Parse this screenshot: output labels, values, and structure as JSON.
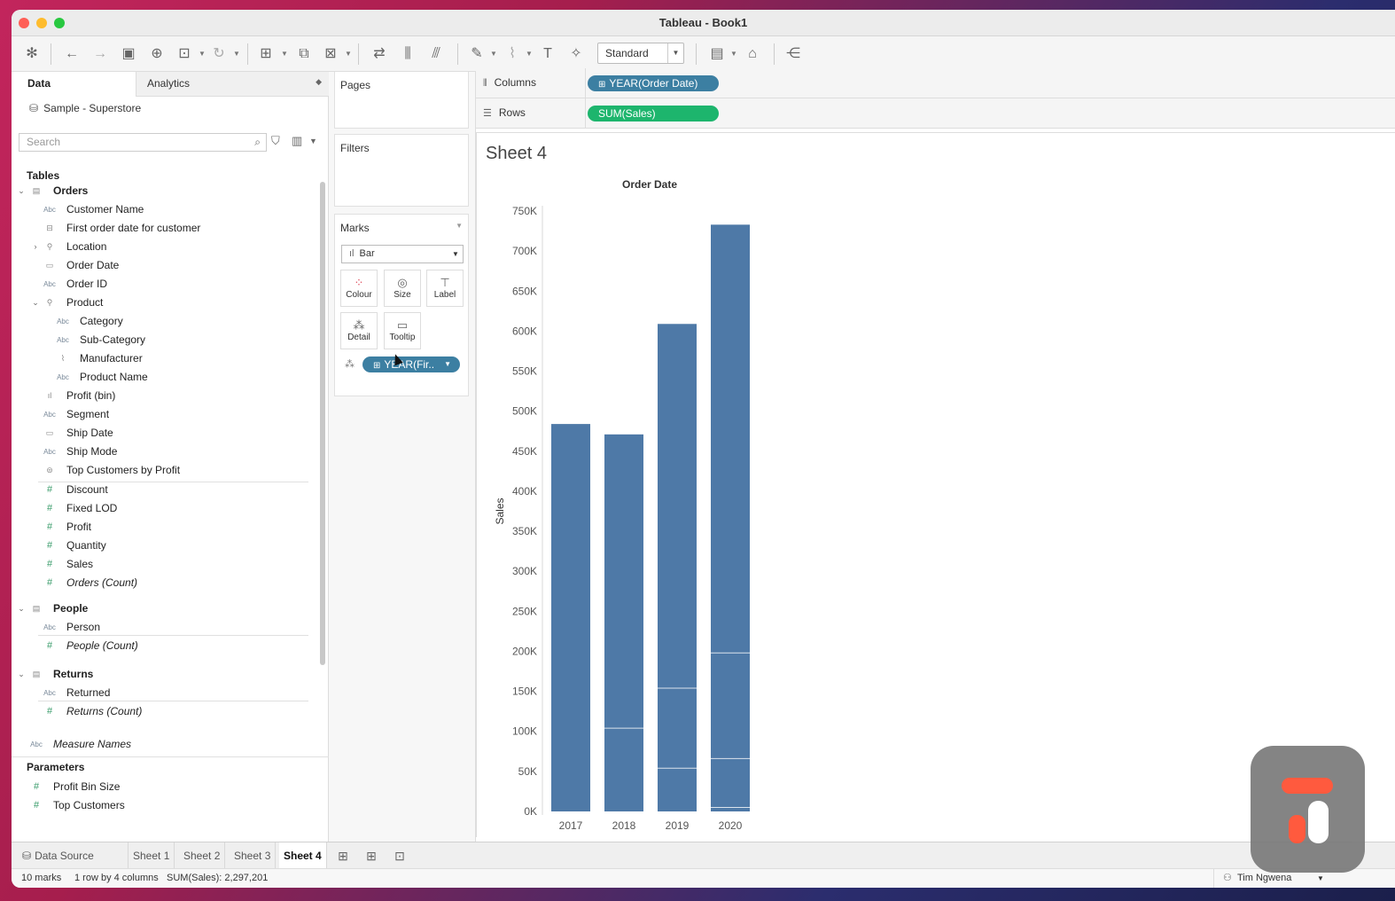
{
  "window": {
    "title": "Tableau - Book1"
  },
  "toolbar": {
    "view_select": "Standard"
  },
  "data_pane": {
    "tab_data": "Data",
    "tab_analytics": "Analytics",
    "datasource": "Sample - Superstore",
    "search_placeholder": "Search",
    "tables_heading": "Tables",
    "tables": [
      {
        "name": "Orders",
        "fields": [
          {
            "icon": "Abc",
            "name": "Customer Name"
          },
          {
            "icon": "date-group",
            "name": "First order date for customer"
          },
          {
            "icon": "hierarchy",
            "name": "Location"
          },
          {
            "icon": "date",
            "name": "Order Date"
          },
          {
            "icon": "Abc",
            "name": "Order ID"
          },
          {
            "icon": "hierarchy",
            "name": "Product"
          },
          {
            "icon": "Abc",
            "name": "Category"
          },
          {
            "icon": "Abc",
            "name": "Sub-Category"
          },
          {
            "icon": "clip",
            "name": "Manufacturer"
          },
          {
            "icon": "Abc",
            "name": "Product Name"
          },
          {
            "icon": "bin",
            "name": "Profit (bin)"
          },
          {
            "icon": "Abc",
            "name": "Segment"
          },
          {
            "icon": "date",
            "name": "Ship Date"
          },
          {
            "icon": "Abc",
            "name": "Ship Mode"
          },
          {
            "icon": "set",
            "name": "Top Customers by Profit"
          },
          {
            "icon": "#",
            "name": "Discount"
          },
          {
            "icon": "#",
            "name": "Fixed LOD"
          },
          {
            "icon": "#",
            "name": "Profit"
          },
          {
            "icon": "#",
            "name": "Quantity"
          },
          {
            "icon": "#",
            "name": "Sales"
          },
          {
            "icon": "#",
            "name": "Orders (Count)"
          }
        ]
      },
      {
        "name": "People",
        "fields": [
          {
            "icon": "Abc",
            "name": "Person"
          },
          {
            "icon": "#",
            "name": "People (Count)"
          }
        ]
      },
      {
        "name": "Returns",
        "fields": [
          {
            "icon": "Abc",
            "name": "Returned"
          },
          {
            "icon": "#",
            "name": "Returns (Count)"
          }
        ]
      }
    ],
    "measure_names": "Measure Names",
    "parameters_heading": "Parameters",
    "parameters": [
      "Profit Bin Size",
      "Top Customers"
    ]
  },
  "shelves": {
    "pages": "Pages",
    "filters": "Filters",
    "marks": "Marks",
    "mark_type": "Bar",
    "mark_buttons": [
      "Colour",
      "Size",
      "Label",
      "Detail",
      "Tooltip"
    ],
    "detail_pill": "YEAR(Fir..",
    "columns_label": "Columns",
    "columns_pill": "YEAR(Order Date)",
    "rows_label": "Rows",
    "rows_pill": "SUM(Sales)"
  },
  "sheet": {
    "title": "Sheet 4"
  },
  "chart_data": {
    "type": "bar",
    "title": "Order Date",
    "xlabel": "",
    "ylabel": "Sales",
    "categories": [
      "2017",
      "2018",
      "2019",
      "2020"
    ],
    "values": [
      484000,
      471000,
      609000,
      733000
    ],
    "segment_boundaries": [
      [],
      [
        104000
      ],
      [
        54000,
        154000
      ],
      [
        5000,
        66000,
        198000
      ]
    ],
    "ylim": [
      0,
      750000
    ],
    "yticks": [
      "0K",
      "50K",
      "100K",
      "150K",
      "200K",
      "250K",
      "300K",
      "350K",
      "400K",
      "450K",
      "500K",
      "550K",
      "600K",
      "650K",
      "700K",
      "750K"
    ],
    "bar_color": "#4e79a7",
    "grid": false
  },
  "tabs": {
    "data_source": "Data Source",
    "sheets": [
      "Sheet 1",
      "Sheet 2",
      "Sheet 3",
      "Sheet 4"
    ],
    "active": "Sheet 4"
  },
  "status": {
    "marks": "10 marks",
    "dims": "1 row by 4 columns",
    "sum": "SUM(Sales): 2,297,201",
    "user": "Tim Ngwena"
  },
  "colors": {
    "pill_blue": "#3c7fa2",
    "pill_green": "#1db56d",
    "logo_accent": "#ff4d2e"
  }
}
